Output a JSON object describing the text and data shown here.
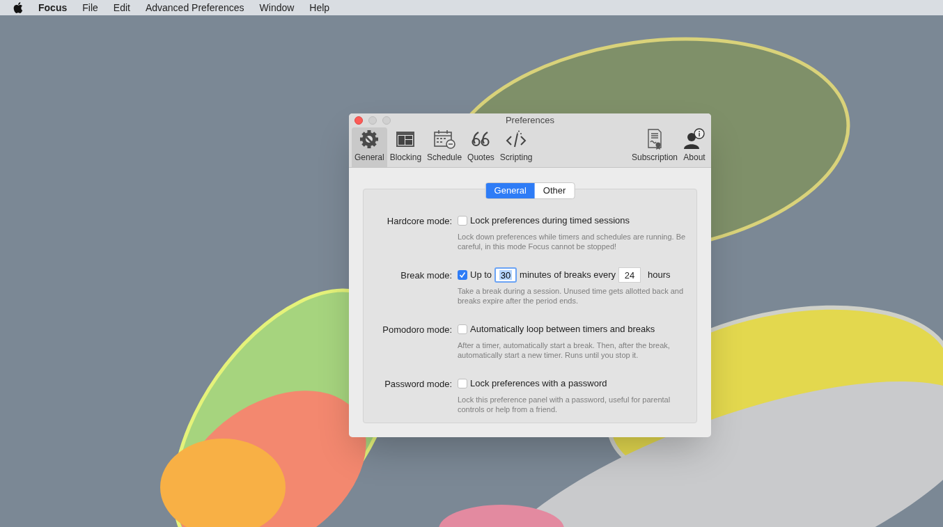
{
  "menubar": {
    "items": [
      {
        "label": "Focus"
      },
      {
        "label": "File"
      },
      {
        "label": "Edit"
      },
      {
        "label": "Advanced Preferences"
      },
      {
        "label": "Window"
      },
      {
        "label": "Help"
      }
    ]
  },
  "window": {
    "title": "Preferences",
    "toolbar": [
      {
        "label": "General",
        "selected": true
      },
      {
        "label": "Blocking",
        "selected": false
      },
      {
        "label": "Schedule",
        "selected": false
      },
      {
        "label": "Quotes",
        "selected": false
      },
      {
        "label": "Scripting",
        "selected": false
      }
    ],
    "toolbar_right": [
      {
        "label": "Subscription",
        "selected": false
      },
      {
        "label": "About",
        "selected": false
      }
    ],
    "segments": [
      {
        "label": "General",
        "selected": true
      },
      {
        "label": "Other",
        "selected": false
      }
    ],
    "rows": [
      {
        "kind": "checkbox",
        "label": "Hardcore mode:",
        "checked": false,
        "text": "Lock preferences during timed sessions",
        "description": "Lock down preferences while timers and schedules are running. Be careful, in this mode Focus cannot be stopped!"
      },
      {
        "kind": "break",
        "label": "Break mode:",
        "checked": true,
        "parts": [
          {
            "kind": "text",
            "text": "Up to"
          },
          {
            "kind": "field",
            "value": "30",
            "focused": true
          },
          {
            "kind": "text",
            "text": "minutes of breaks every"
          },
          {
            "kind": "field",
            "value": "24",
            "focused": false
          },
          {
            "kind": "text",
            "text": "hours"
          }
        ],
        "description": "Take a break during a session. Unused time gets allotted back and breaks expire after the period ends."
      },
      {
        "kind": "checkbox",
        "label": "Pomodoro mode:",
        "checked": false,
        "text": "Automatically loop between timers and breaks",
        "description": "After a timer, automatically start a break. Then, after the break, automatically start a new timer. Runs until you stop it."
      },
      {
        "kind": "checkbox",
        "label": "Password mode:",
        "checked": false,
        "text": "Lock preferences with a password",
        "description": "Lock this preference panel with a password, useful for parental controls or help from a friend."
      }
    ]
  }
}
